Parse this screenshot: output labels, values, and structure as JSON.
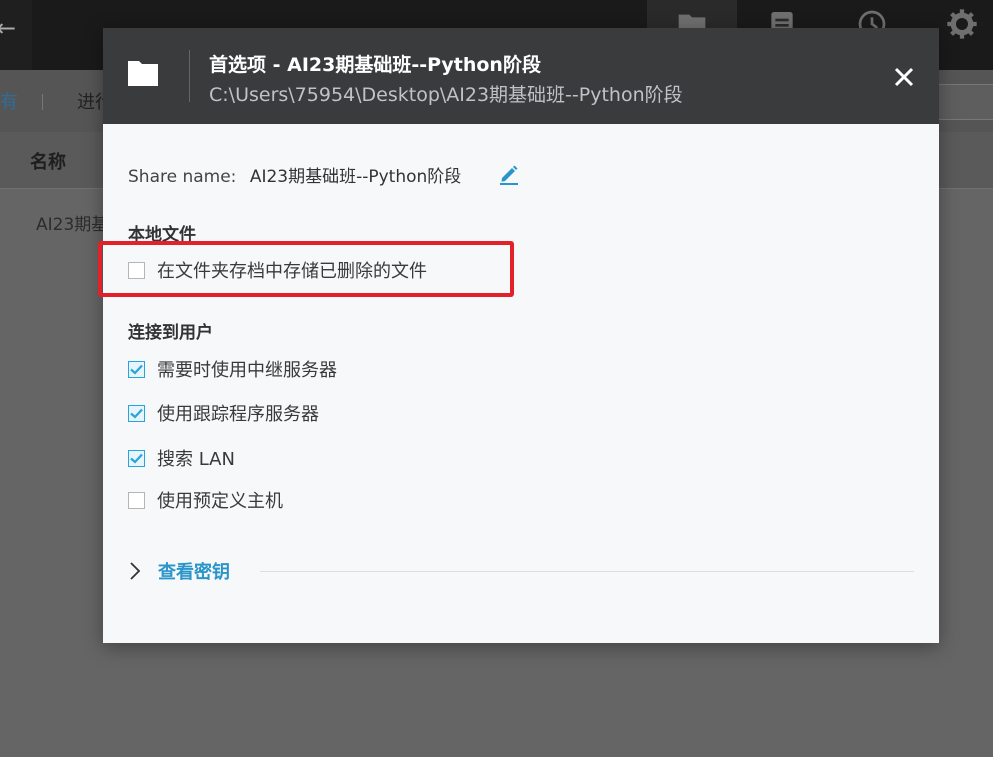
{
  "background": {
    "toolbar": {
      "left_text": "有",
      "mid_text": "进行"
    },
    "table": {
      "header_name": "名称",
      "row1_name": "AI23期基"
    },
    "top_icons": [
      "folder-icon",
      "document-icon",
      "clock-icon",
      "gear-icon"
    ]
  },
  "dialog": {
    "title": "首选项 - AI23期基础班--Python阶段",
    "path": "C:\\Users\\75954\\Desktop\\AI23期基础班--Python阶段",
    "share_name_label": "Share name:",
    "share_name_value": "AI23期基础班--Python阶段",
    "local_files": {
      "title": "本地文件",
      "options": [
        {
          "label": "在文件夹存档中存储已删除的文件",
          "checked": false
        }
      ]
    },
    "connect": {
      "title": "连接到用户",
      "options": [
        {
          "label": "需要时使用中继服务器",
          "checked": true
        },
        {
          "label": "使用跟踪程序服务器",
          "checked": true
        },
        {
          "label": "搜索 LAN",
          "checked": true
        },
        {
          "label": "使用预定义主机",
          "checked": false
        }
      ]
    },
    "view_keys_label": "查看密钥"
  },
  "colors": {
    "accent": "#2a95c9",
    "highlight_box": "#e3212a",
    "header_bg": "#3a3b3d"
  }
}
